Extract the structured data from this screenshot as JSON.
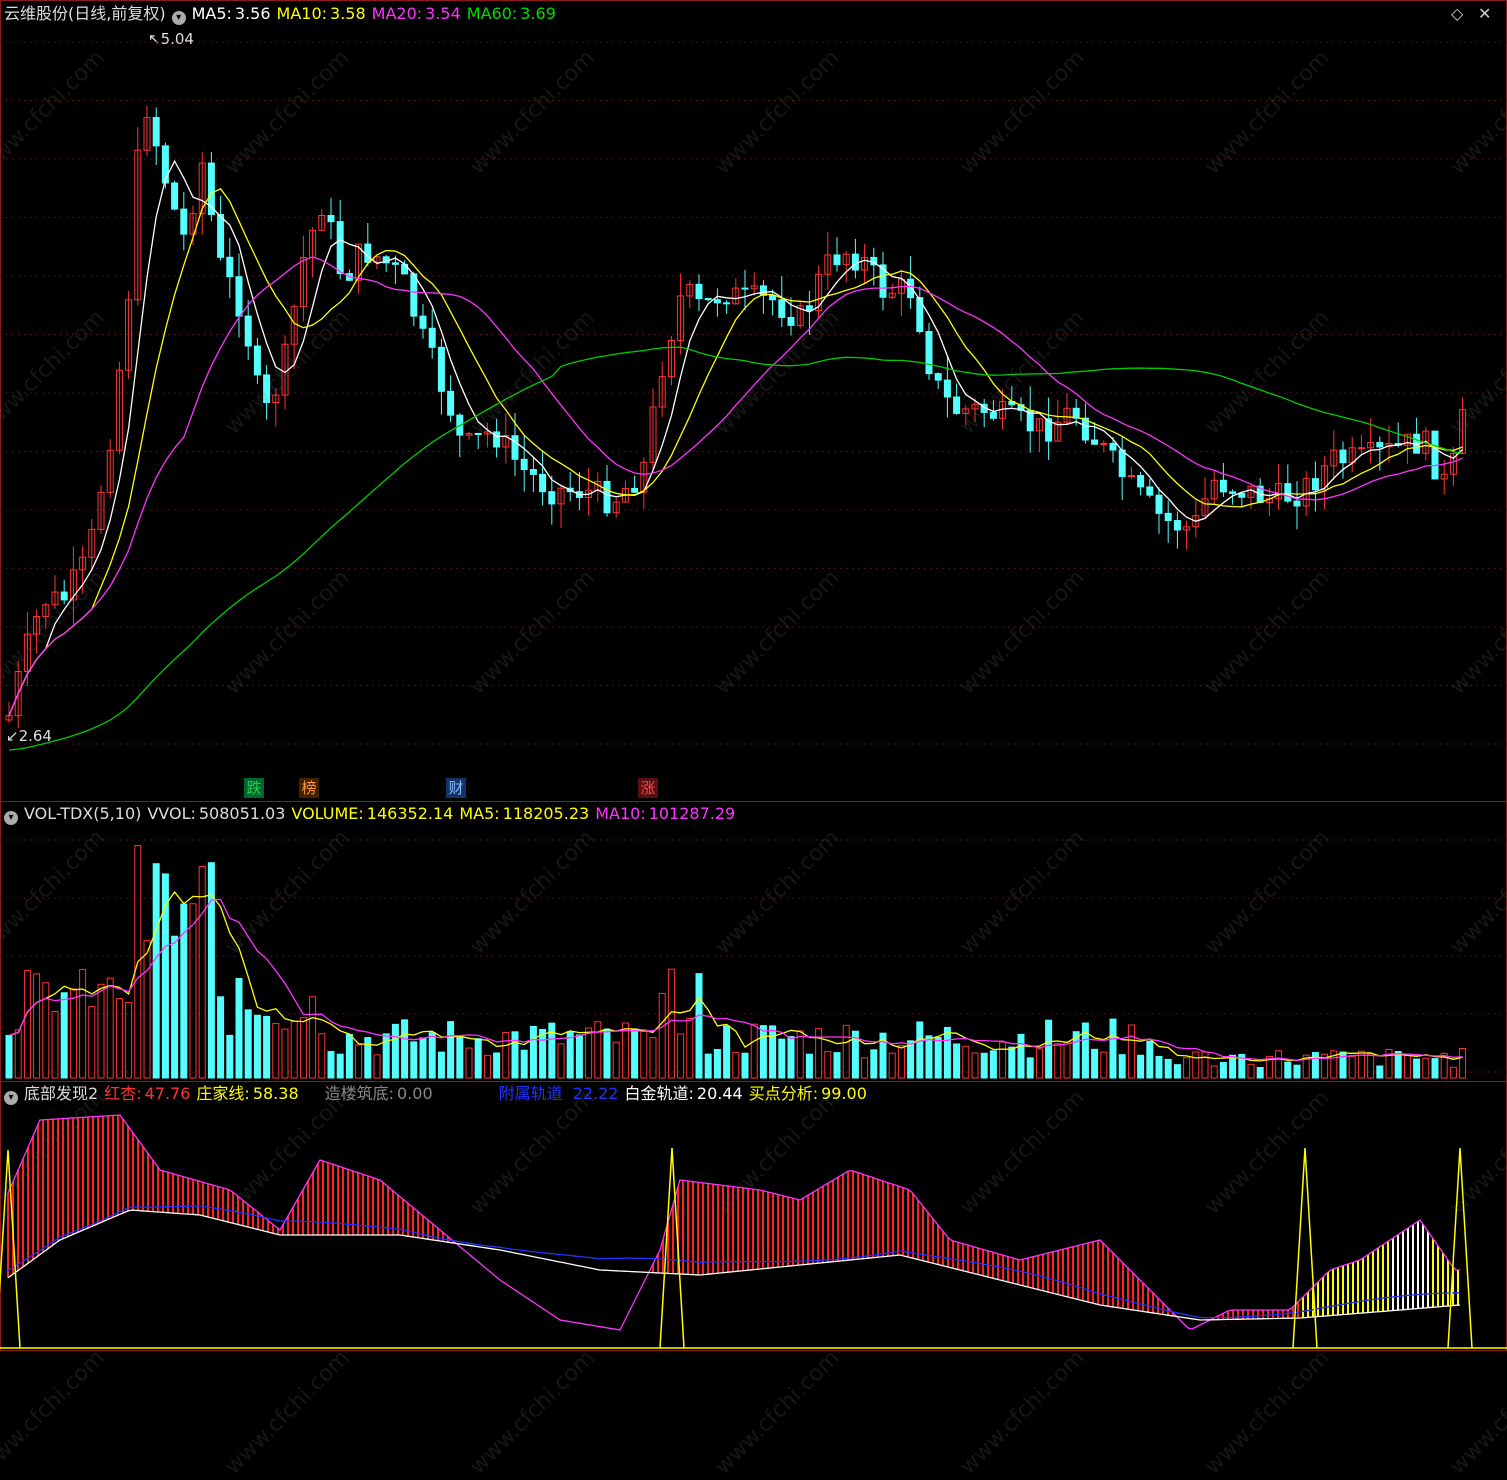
{
  "main": {
    "title": "云维股份(日线,前复权)",
    "ma5_label": "MA5:",
    "ma5_value": "3.56",
    "ma10_label": "MA10:",
    "ma10_value": "3.58",
    "ma20_label": "MA20:",
    "ma20_value": "3.54",
    "ma60_label": "MA60:",
    "ma60_value": "3.69",
    "high_label": "5.04",
    "low_label": "2.64",
    "tags": [
      {
        "text": "跌",
        "color": "#2ecc40"
      },
      {
        "text": "榜",
        "color": "#ff9933"
      },
      {
        "text": "财",
        "color": "#66aaff"
      },
      {
        "text": "涨",
        "color": "#ff3333"
      }
    ],
    "colors": {
      "ma5": "#ffffff",
      "ma10": "#ffff00",
      "ma20": "#ff33ff",
      "ma60": "#00cc00",
      "up": "#ff3333",
      "down": "#54ffff"
    }
  },
  "volume": {
    "indicator": "VOL-TDX(5,10)",
    "vvol_label": "VVOL:",
    "vvol_value": "508051.03",
    "volume_label": "VOLUME:",
    "volume_value": "146352.14",
    "ma5_label": "MA5:",
    "ma5_value": "118205.23",
    "ma10_label": "MA10:",
    "ma10_value": "101287.29"
  },
  "bottom": {
    "indicator": "底部发现2",
    "hongxing_label": "红杏:",
    "hongxing_value": "47.76",
    "zhuangjia_label": "庄家线:",
    "zhuangjia_value": "58.38",
    "zaolou_label": "造楼筑底:",
    "zaolou_value": "0.00",
    "fushu_label": "附属轨道",
    "fushu_value": "22.22",
    "baijin_label": "白金轨道:",
    "baijin_value": "20.44",
    "maidian_label": "买点分析:",
    "maidian_value": "99.00"
  },
  "window_controls": {
    "diamond_icon": "◇",
    "close_icon": "✕"
  },
  "watermark": "www.cfchi.com",
  "chart_data": [
    {
      "type": "candlestick",
      "title": "云维股份(日线,前复权)",
      "ylim": [
        2.64,
        5.04
      ],
      "series": [
        {
          "name": "MA5",
          "values": [
            3.56
          ]
        },
        {
          "name": "MA10",
          "values": [
            3.58
          ]
        },
        {
          "name": "MA20",
          "values": [
            3.54
          ]
        },
        {
          "name": "MA60",
          "values": [
            3.69
          ]
        }
      ]
    },
    {
      "type": "bar",
      "title": "VOL-TDX(5,10)",
      "series": [
        {
          "name": "VOLUME",
          "values": [
            146352.14
          ]
        },
        {
          "name": "MA5",
          "values": [
            118205.23
          ]
        },
        {
          "name": "MA10",
          "values": [
            101287.29
          ]
        }
      ]
    }
  ]
}
